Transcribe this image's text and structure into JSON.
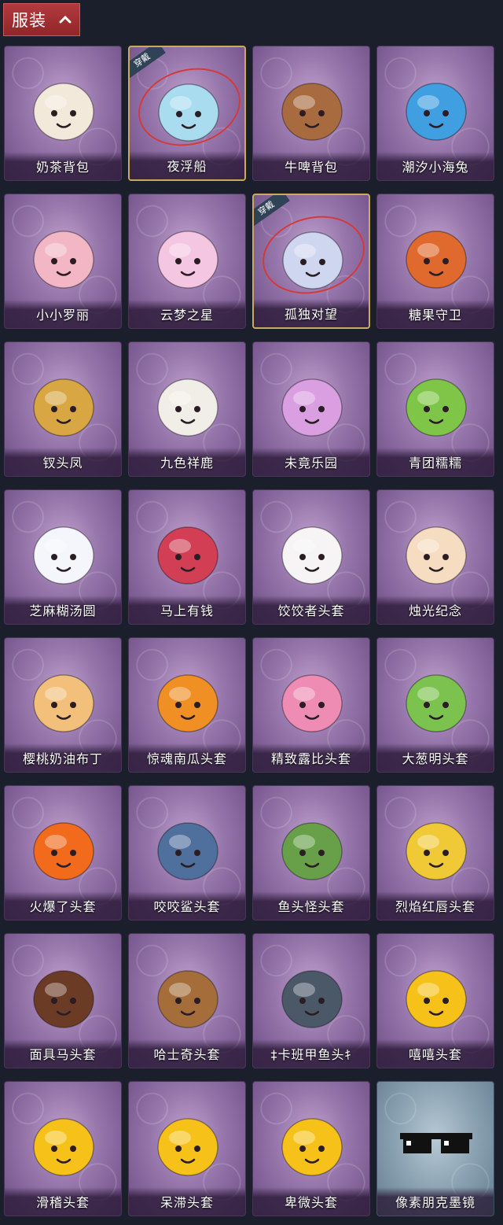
{
  "header": {
    "title": "服装"
  },
  "badge_text": "穿戴",
  "items": [
    {
      "name": "奶茶背包",
      "icon": "milk-tea-backpack-icon",
      "equipped": false,
      "bg": "purple",
      "color": "#f3e9da"
    },
    {
      "name": "夜浮船",
      "icon": "jellyfish-pendant-icon",
      "equipped": true,
      "bg": "purple",
      "color": "#a9dcef"
    },
    {
      "name": "牛啤背包",
      "icon": "cow-beer-backpack-icon",
      "equipped": false,
      "bg": "purple",
      "color": "#a86b3f"
    },
    {
      "name": "潮汐小海兔",
      "icon": "sea-bunny-icon",
      "equipped": false,
      "bg": "purple",
      "color": "#3f9fe0"
    },
    {
      "name": "小小罗丽",
      "icon": "little-loli-doll-icon",
      "equipped": false,
      "bg": "purple",
      "color": "#f2b6c4"
    },
    {
      "name": "云梦之星",
      "icon": "unicorn-cloud-icon",
      "equipped": false,
      "bg": "purple",
      "color": "#f5c6e2"
    },
    {
      "name": "孤独对望",
      "icon": "angel-doll-pendant-icon",
      "equipped": true,
      "bg": "purple",
      "color": "#cfd6f0"
    },
    {
      "name": "糖果守卫",
      "icon": "pumpkin-scarecrow-icon",
      "equipped": false,
      "bg": "purple",
      "color": "#e0692d"
    },
    {
      "name": "钗头凤",
      "icon": "phoenix-crown-doll-icon",
      "equipped": false,
      "bg": "purple",
      "color": "#d8a642"
    },
    {
      "name": "九色祥鹿",
      "icon": "deer-pendant-icon",
      "equipped": false,
      "bg": "purple",
      "color": "#f0eee6"
    },
    {
      "name": "未竟乐园",
      "icon": "fairy-doll-icon",
      "equipped": false,
      "bg": "purple",
      "color": "#d99fe0"
    },
    {
      "name": "青团糯糯",
      "icon": "green-rice-ball-icon",
      "equipped": false,
      "bg": "purple",
      "color": "#7fc648"
    },
    {
      "name": "芝麻糊汤圆",
      "icon": "rice-dumpling-icon",
      "equipped": false,
      "bg": "purple",
      "color": "#f4f6fb"
    },
    {
      "name": "马上有钱",
      "icon": "red-horse-head-icon",
      "equipped": false,
      "bg": "purple",
      "color": "#d23f55"
    },
    {
      "name": "饺饺者头套",
      "icon": "dumpling-head-icon",
      "equipped": false,
      "bg": "purple",
      "color": "#f6f4f4"
    },
    {
      "name": "烛光纪念",
      "icon": "candle-head-icon",
      "equipped": false,
      "bg": "purple",
      "color": "#f6dcc0"
    },
    {
      "name": "樱桃奶油布丁",
      "icon": "pudding-icon",
      "equipped": false,
      "bg": "purple",
      "color": "#f2c07a"
    },
    {
      "name": "惊魂南瓜头套",
      "icon": "pumpkin-head-icon",
      "equipped": false,
      "bg": "purple",
      "color": "#ef8f24"
    },
    {
      "name": "精致露比头套",
      "icon": "pink-beaver-head-icon",
      "equipped": false,
      "bg": "purple",
      "color": "#ee8cb4"
    },
    {
      "name": "大葱明头套",
      "icon": "scallion-head-icon",
      "equipped": false,
      "bg": "purple",
      "color": "#7cc24f"
    },
    {
      "name": "火爆了头套",
      "icon": "fire-head-icon",
      "equipped": false,
      "bg": "purple",
      "color": "#f26a1c"
    },
    {
      "name": "咬咬鲨头套",
      "icon": "shark-head-icon",
      "equipped": false,
      "bg": "purple",
      "color": "#4f6f9d"
    },
    {
      "name": "鱼头怪头套",
      "icon": "fish-head-mask-icon",
      "equipped": false,
      "bg": "purple",
      "color": "#68a049"
    },
    {
      "name": "烈焰红唇头套",
      "icon": "yellow-mouse-head-icon",
      "equipped": false,
      "bg": "purple",
      "color": "#f0c936"
    },
    {
      "name": "面具马头套",
      "icon": "horse-mask-icon",
      "equipped": false,
      "bg": "purple",
      "color": "#6b3b25"
    },
    {
      "name": "哈士奇头套",
      "icon": "husky-head-icon",
      "equipped": false,
      "bg": "purple",
      "color": "#a46d3a"
    },
    {
      "name": "‡卡班甲鱼头ｷ",
      "icon": "turtle-head-icon",
      "equipped": false,
      "bg": "purple",
      "color": "#4b5868"
    },
    {
      "name": "嘻嘻头套",
      "icon": "grin-emoji-head-icon",
      "equipped": false,
      "bg": "purple",
      "color": "#f6c21a"
    },
    {
      "name": "滑稽头套",
      "icon": "smirk-emoji-head-icon",
      "equipped": false,
      "bg": "purple",
      "color": "#f6c21a"
    },
    {
      "name": "呆滞头套",
      "icon": "stare-emoji-head-icon",
      "equipped": false,
      "bg": "purple",
      "color": "#f6c21a"
    },
    {
      "name": "卑微头套",
      "icon": "timid-emoji-head-icon",
      "equipped": false,
      "bg": "purple",
      "color": "#f6c21a"
    },
    {
      "name": "像素朋克墨镜",
      "icon": "pixel-sunglasses-icon",
      "equipped": false,
      "bg": "blue",
      "color": "#111111"
    }
  ]
}
